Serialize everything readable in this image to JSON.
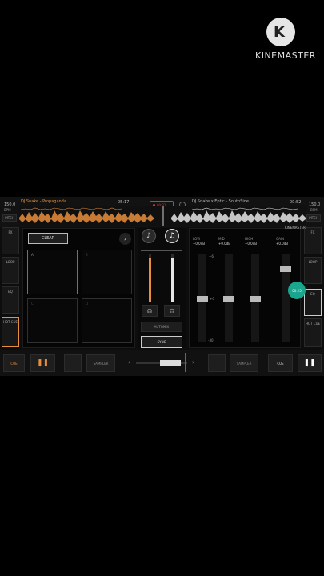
{
  "watermark": {
    "brand": "KINEMASTER"
  },
  "deck_a": {
    "bpm": "150.0",
    "bpm_unit": "BPM",
    "pitch_label": "PITCH",
    "track": "DJ Snake - Propaganda",
    "time": "05:17",
    "mode_buttons": [
      "FX",
      "LOOP",
      "EQ",
      "HOT CUE"
    ],
    "clear_label": "CLEAR",
    "pads": [
      "A",
      "B",
      "C",
      "D"
    ],
    "cue_label": "CUE",
    "sampler_label": "SAMPLER"
  },
  "deck_b": {
    "bpm": "150.0",
    "bpm_unit": "BPM",
    "pitch_label": "PITCH",
    "track": "DJ Snake x Eptic - SouthSide",
    "time": "00:52",
    "mode_buttons": [
      "FX",
      "LOOP",
      "EQ",
      "HOT CUE"
    ],
    "cue_label": "CUE",
    "sampler_label": "SAMPLER"
  },
  "record": {
    "time": "00:21"
  },
  "mixer": {
    "automix_label": "AUTOMIX",
    "sync_label": "SYNC",
    "eq": [
      {
        "label": "LOW",
        "value": "+0.0dB"
      },
      {
        "label": "MID",
        "value": "+0.0dB"
      },
      {
        "label": "HIGH",
        "value": "+0.0dB"
      },
      {
        "label": "GAIN",
        "value": "+0.0dB"
      }
    ],
    "scale_top": "+6",
    "scale_mid": "+0",
    "scale_bottom": "-30"
  },
  "overlay": {
    "brand": "KINEMASTER",
    "bubble_time": "00:25"
  },
  "colors": {
    "deck_a": "#e88e3c",
    "deck_b": "#e6e6e6",
    "record": "#e0332c",
    "bubble": "#1aa58e"
  }
}
